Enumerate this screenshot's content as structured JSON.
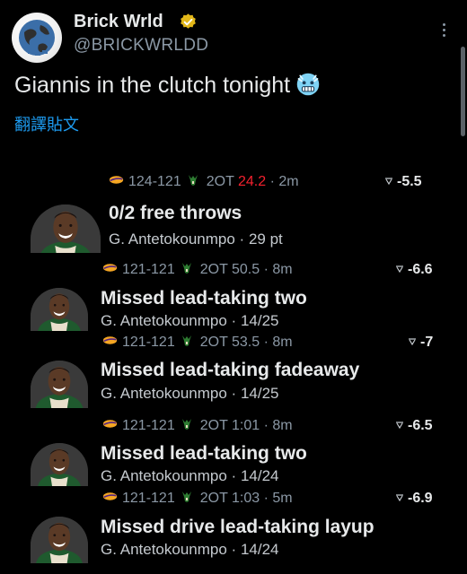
{
  "author": {
    "display_name": "Brick Wrld",
    "handle": "@BRICKWRLDD"
  },
  "tweet": {
    "text": "Giannis in the clutch tonight",
    "emoji": "freezing-face-emoji",
    "translate_label": "翻譯貼文"
  },
  "plays": [
    {
      "score": "124-121",
      "period": "2OT",
      "clock": "24.2",
      "clock_highlight": true,
      "ago": "2m",
      "odds": "-5.5",
      "title": "0/2 free throws",
      "player": "G. Antetokounmpo",
      "stat": "29 pt"
    },
    {
      "score": "121-121",
      "period": "2OT",
      "clock": "50.5",
      "clock_highlight": false,
      "ago": "8m",
      "odds": "-6.6",
      "title": "Missed lead-taking two",
      "player": "G. Antetokounmpo",
      "stat": "14/25"
    },
    {
      "score": "121-121",
      "period": "2OT",
      "clock": "53.5",
      "clock_highlight": false,
      "ago": "8m",
      "odds": "-7",
      "title": "Missed lead-taking fadeaway",
      "player": "G. Antetokounmpo",
      "stat": "14/25"
    },
    {
      "score": "121-121",
      "period": "2OT",
      "clock": "1:01",
      "clock_highlight": false,
      "ago": "8m",
      "odds": "-6.5",
      "title": "Missed lead-taking two",
      "player": "G. Antetokounmpo",
      "stat": "14/24"
    },
    {
      "score": "121-121",
      "period": "2OT",
      "clock": "1:03",
      "clock_highlight": false,
      "ago": "5m",
      "odds": "-6.9",
      "title": "Missed drive lead-taking layup",
      "player": "G. Antetokounmpo",
      "stat": "14/24"
    }
  ],
  "colors": {
    "background": "#000000",
    "link": "#1d9bf0",
    "verified": "#e2b719",
    "clock_highlight": "#f4212e",
    "secondary_text": "#8b98a5"
  }
}
